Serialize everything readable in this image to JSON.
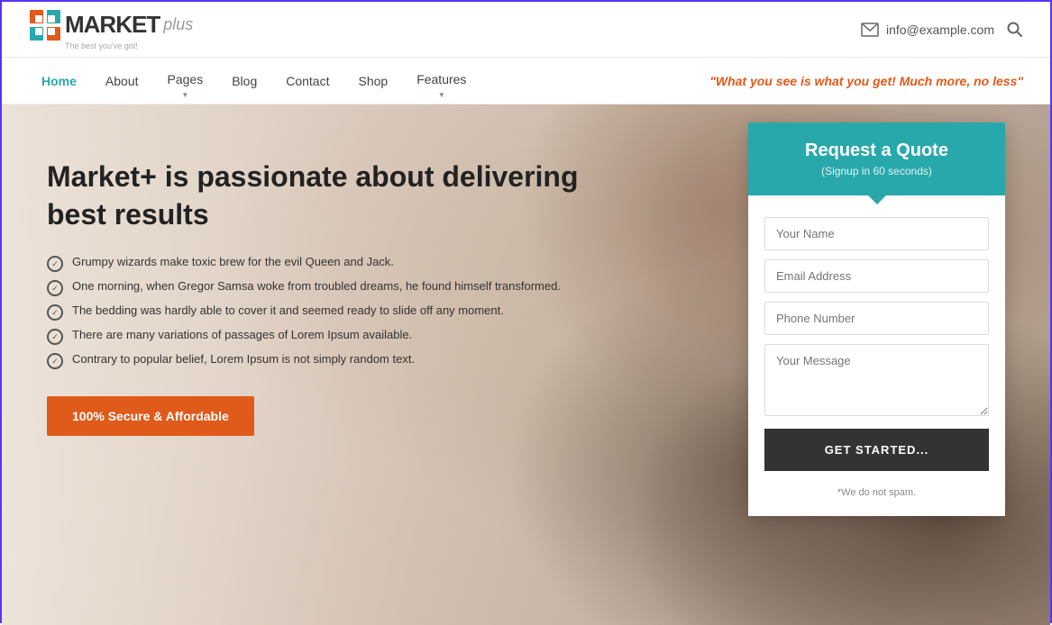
{
  "topbar": {
    "email": "info@example.com",
    "search_label": "search"
  },
  "logo": {
    "text_market": "MARKET",
    "text_plus": "plus",
    "tagline": "The best you've got!"
  },
  "nav": {
    "items": [
      {
        "label": "Home",
        "active": true,
        "has_dropdown": false
      },
      {
        "label": "About",
        "active": false,
        "has_dropdown": false
      },
      {
        "label": "Pages",
        "active": false,
        "has_dropdown": true
      },
      {
        "label": "Blog",
        "active": false,
        "has_dropdown": false
      },
      {
        "label": "Contact",
        "active": false,
        "has_dropdown": false
      },
      {
        "label": "Shop",
        "active": false,
        "has_dropdown": false
      },
      {
        "label": "Features",
        "active": false,
        "has_dropdown": true
      }
    ],
    "tagline": "\"What you see is what you get! Much more, no less\""
  },
  "hero": {
    "title": "Market+ is passionate about delivering best results",
    "bullets": [
      "Grumpy wizards make toxic brew for the evil Queen and Jack.",
      "One morning, when Gregor Samsa woke from troubled dreams, he found himself transformed.",
      "The bedding was hardly able to cover it and seemed ready to slide off any moment.",
      "There are many variations of passages of Lorem Ipsum available.",
      "Contrary to popular belief, Lorem Ipsum is not simply random text."
    ],
    "cta_label": "100% Secure & Affordable"
  },
  "quote_form": {
    "title": "Request a Quote",
    "subtitle": "(Signup in 60 seconds)",
    "name_placeholder": "Your Name",
    "email_placeholder": "Email Address",
    "phone_placeholder": "Phone Number",
    "message_placeholder": "Your Message",
    "button_label": "GET STARTED...",
    "no_spam": "*We do not spam."
  },
  "colors": {
    "teal": "#29a8ab",
    "orange": "#e05a1a",
    "dark": "#333"
  }
}
